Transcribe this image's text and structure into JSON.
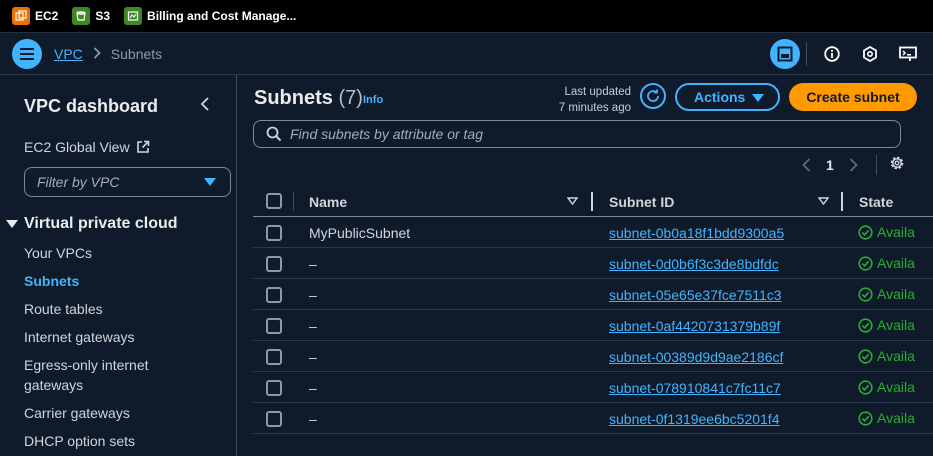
{
  "favorites": [
    {
      "label": "EC2",
      "icon": "ec2-icon",
      "color": "#ed7100"
    },
    {
      "label": "S3",
      "icon": "s3-icon",
      "color": "#3f8624"
    },
    {
      "label": "Billing and Cost Manage...",
      "icon": "billing-icon",
      "color": "#3f8624"
    }
  ],
  "breadcrumb": {
    "parent": "VPC",
    "current": "Subnets"
  },
  "sidebar": {
    "title": "VPC dashboard",
    "global_view": "EC2 Global View",
    "filter_placeholder": "Filter by VPC",
    "section": "Virtual private cloud",
    "items": [
      {
        "label": "Your VPCs",
        "active": false
      },
      {
        "label": "Subnets",
        "active": true
      },
      {
        "label": "Route tables",
        "active": false
      },
      {
        "label": "Internet gateways",
        "active": false
      },
      {
        "label": "Egress-only internet",
        "active": false
      },
      {
        "label": "gateways",
        "active": false
      },
      {
        "label": "Carrier gateways",
        "active": false
      },
      {
        "label": "DHCP option sets",
        "active": false
      }
    ]
  },
  "header": {
    "title": "Subnets",
    "count": "(7)",
    "info": "Info",
    "last_updated_label": "Last updated",
    "last_updated_value": "7 minutes ago",
    "actions_label": "Actions",
    "create_label": "Create subnet"
  },
  "search": {
    "placeholder": "Find subnets by attribute or tag"
  },
  "pagination": {
    "current_page": "1"
  },
  "table": {
    "columns": [
      "Name",
      "Subnet ID",
      "State"
    ],
    "rows": [
      {
        "name": "MyPublicSubnet",
        "subnet_id": "subnet-0b0a18f1bdd9300a5",
        "state": "Availa"
      },
      {
        "name": "–",
        "subnet_id": "subnet-0d0b6f3c3de8bdfdc",
        "state": "Availa"
      },
      {
        "name": "–",
        "subnet_id": "subnet-05e65e37fce7511c3",
        "state": "Availa"
      },
      {
        "name": "–",
        "subnet_id": "subnet-0af4420731379b89f",
        "state": "Availa"
      },
      {
        "name": "–",
        "subnet_id": "subnet-00389d9d9ae2186cf",
        "state": "Availa"
      },
      {
        "name": "–",
        "subnet_id": "subnet-078910841c7fc11c7",
        "state": "Availa"
      },
      {
        "name": "–",
        "subnet_id": "subnet-0f1319ee6bc5201f4",
        "state": "Availa"
      }
    ]
  },
  "colors": {
    "accent": "#42b4ff",
    "primary_button": "#ff9900",
    "available": "#29ad32",
    "background": "#0f1b2a"
  }
}
